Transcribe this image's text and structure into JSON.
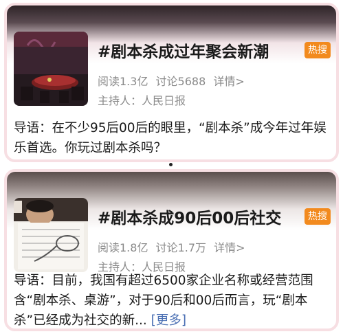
{
  "cards": [
    {
      "title": "#剧本杀成过年聚会新潮",
      "badge": "热搜",
      "reads": "阅读1.3亿",
      "discussions": "讨论5688",
      "details": "详情>",
      "host": "主持人：人民日报",
      "description": "导语：在不少95后00后的眼里，“剧本杀”成今年过年娱乐首选。你玩过剧本杀吗？",
      "more": ""
    },
    {
      "title": "#剧本杀成90后00后社交",
      "badge": "热搜",
      "reads": "阅读1.8亿",
      "discussions": "讨论1.7万",
      "details": "详情>",
      "host": "主持人：人民日报",
      "description": "导语：目前，我国有超过6500家企业名称或经营范围含“剧本杀、桌游”，对于90后和00后而言，玩“剧本杀”已经成为社交的新...",
      "more": "[更多]"
    }
  ],
  "colors": {
    "badge": "#f28a1e",
    "more_link": "#4a6fb3",
    "card_border": "#f7dfe3"
  }
}
